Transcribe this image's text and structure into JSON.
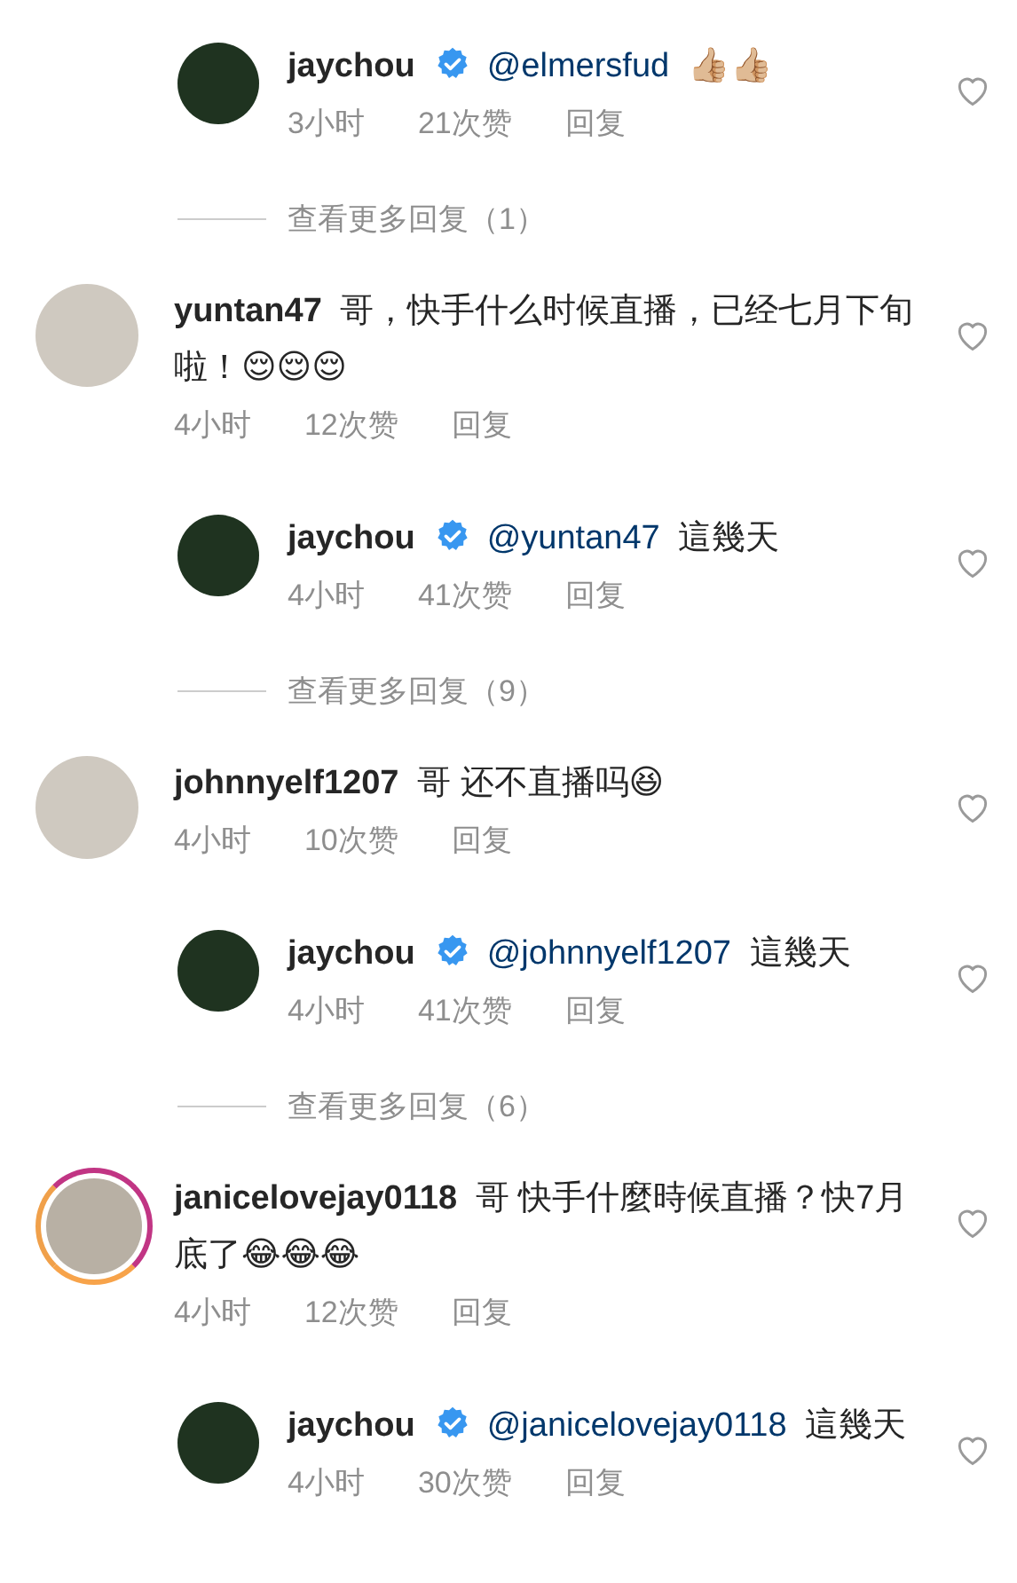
{
  "items": [
    {
      "kind": "reply",
      "username": "jaychou",
      "verified": true,
      "mention": "@elmersfud",
      "text": "👍🏼👍🏼",
      "time": "3小时",
      "likes": "21次赞",
      "reply": "回复"
    },
    {
      "kind": "view_more",
      "label": "查看更多回复（1）"
    },
    {
      "kind": "comment",
      "username": "yuntan47",
      "story_ring": false,
      "text": "哥，快手什么时候直播，已经七月下旬啦！😌😌😌",
      "time": "4小时",
      "likes": "12次赞",
      "reply": "回复"
    },
    {
      "kind": "reply",
      "username": "jaychou",
      "verified": true,
      "mention": "@yuntan47",
      "text": "這幾天",
      "time": "4小时",
      "likes": "41次赞",
      "reply": "回复"
    },
    {
      "kind": "view_more",
      "label": "查看更多回复（9）"
    },
    {
      "kind": "comment",
      "username": "johnnyelf1207",
      "story_ring": false,
      "text": "哥 还不直播吗😆",
      "time": "4小时",
      "likes": "10次赞",
      "reply": "回复"
    },
    {
      "kind": "reply",
      "username": "jaychou",
      "verified": true,
      "mention": "@johnnyelf1207",
      "text": "這幾天",
      "time": "4小时",
      "likes": "41次赞",
      "reply": "回复"
    },
    {
      "kind": "view_more",
      "label": "查看更多回复（6）"
    },
    {
      "kind": "comment",
      "username": "janicelovejay0118",
      "story_ring": true,
      "text": "哥 快手什麼時候直播？快7月底了😂😂😂",
      "time": "4小时",
      "likes": "12次赞",
      "reply": "回复"
    },
    {
      "kind": "reply",
      "username": "jaychou",
      "verified": true,
      "mention": "@janicelovejay0118",
      "text": "這幾天",
      "time": "4小时",
      "likes": "30次赞",
      "reply": "回复"
    }
  ]
}
